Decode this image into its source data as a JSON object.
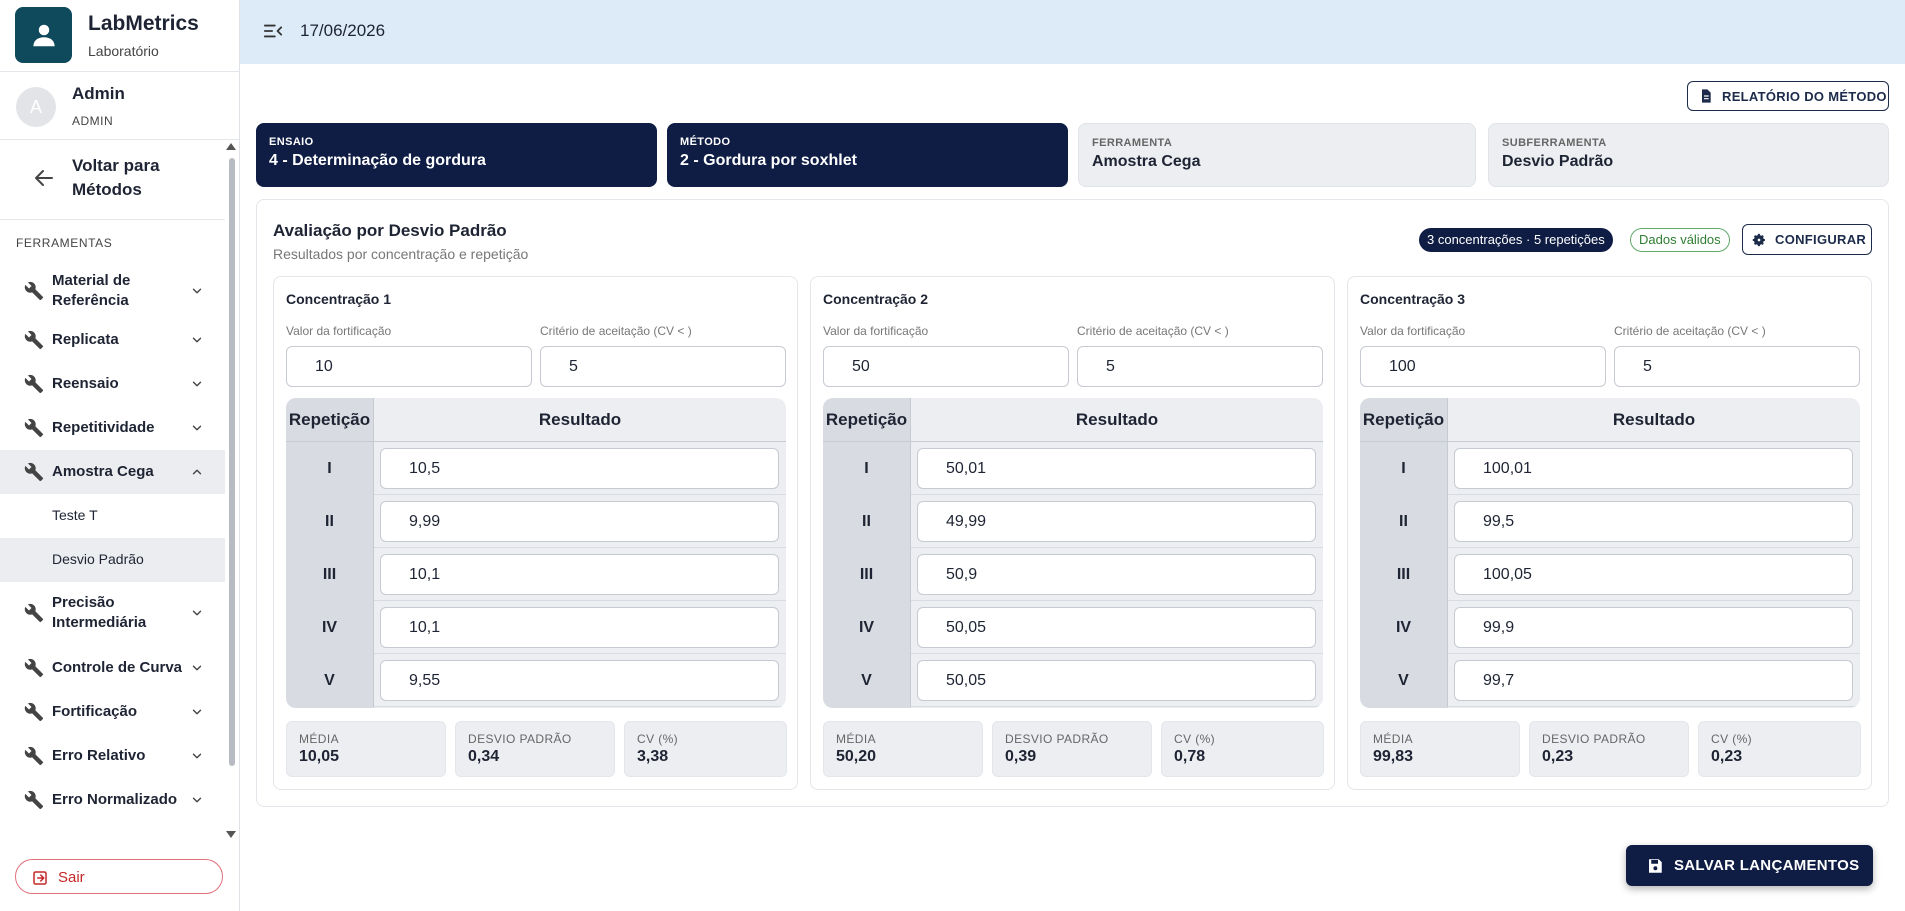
{
  "app": {
    "name": "LabMetrics",
    "subtitle": "Laboratório"
  },
  "user": {
    "initial": "A",
    "name": "Admin",
    "role": "ADMIN"
  },
  "sidebar": {
    "back_label": "Voltar para Métodos",
    "section_title": "FERRAMENTAS",
    "items": [
      {
        "label": "Material de Referência"
      },
      {
        "label": "Replicata"
      },
      {
        "label": "Reensaio"
      },
      {
        "label": "Repetitividade"
      },
      {
        "label": "Amostra Cega",
        "expanded": true,
        "children": [
          {
            "label": "Teste T"
          },
          {
            "label": "Desvio Padrão",
            "active": true
          }
        ]
      },
      {
        "label": "Precisão Intermediária"
      },
      {
        "label": "Controle de Curva"
      },
      {
        "label": "Fortificação"
      },
      {
        "label": "Erro Relativo"
      },
      {
        "label": "Erro Normalizado"
      }
    ],
    "logout_label": "Sair"
  },
  "topbar": {
    "date": "17/06/2026"
  },
  "report_button": "RELATÓRIO DO MÉTODO",
  "breadcrumb": [
    {
      "key": "ENSAIO",
      "value": "4 - Determinação de gordura"
    },
    {
      "key": "MÉTODO",
      "value": "2 - Gordura por soxhlet"
    },
    {
      "key": "FERRAMENTA",
      "value": "Amostra Cega"
    },
    {
      "key": "SUBFERRAMENTA",
      "value": "Desvio Padrão"
    }
  ],
  "panel": {
    "title": "Avaliação por Desvio Padrão",
    "subtitle": "Resultados por concentração e repetição",
    "chip_summary": "3 concentrações · 5 repetições",
    "chip_status": "Dados válidos",
    "config_button": "CONFIGURAR"
  },
  "labels": {
    "fortification": "Valor da fortificação",
    "criteria": "Critério de aceitação (CV < )",
    "repetition": "Repetição",
    "result": "Resultado",
    "mean": "MÉDIA",
    "std": "DESVIO PADRÃO",
    "cv": "CV (%)"
  },
  "concentrations": [
    {
      "title": "Concentração 1",
      "fortification": "10",
      "criteria": "5",
      "rows": [
        {
          "rep": "I",
          "value": "10,5"
        },
        {
          "rep": "II",
          "value": "9,99"
        },
        {
          "rep": "III",
          "value": "10,1"
        },
        {
          "rep": "IV",
          "value": "10,1"
        },
        {
          "rep": "V",
          "value": "9,55"
        }
      ],
      "mean": "10,05",
      "std": "0,34",
      "cv": "3,38"
    },
    {
      "title": "Concentração 2",
      "fortification": "50",
      "criteria": "5",
      "rows": [
        {
          "rep": "I",
          "value": "50,01"
        },
        {
          "rep": "II",
          "value": "49,99"
        },
        {
          "rep": "III",
          "value": "50,9"
        },
        {
          "rep": "IV",
          "value": "50,05"
        },
        {
          "rep": "V",
          "value": "50,05"
        }
      ],
      "mean": "50,20",
      "std": "0,39",
      "cv": "0,78"
    },
    {
      "title": "Concentração 3",
      "fortification": "100",
      "criteria": "5",
      "rows": [
        {
          "rep": "I",
          "value": "100,01"
        },
        {
          "rep": "II",
          "value": "99,5"
        },
        {
          "rep": "III",
          "value": "100,05"
        },
        {
          "rep": "IV",
          "value": "99,9"
        },
        {
          "rep": "V",
          "value": "99,7"
        }
      ],
      "mean": "99,83",
      "std": "0,23",
      "cv": "0,23"
    }
  ],
  "save_button": "SALVAR LANÇAMENTOS",
  "colors": {
    "primary": "#0f1d45",
    "brand": "#0f4a5c",
    "topbar": "#dcebf7",
    "valid": "#2e7d32",
    "logout": "#c62828"
  }
}
